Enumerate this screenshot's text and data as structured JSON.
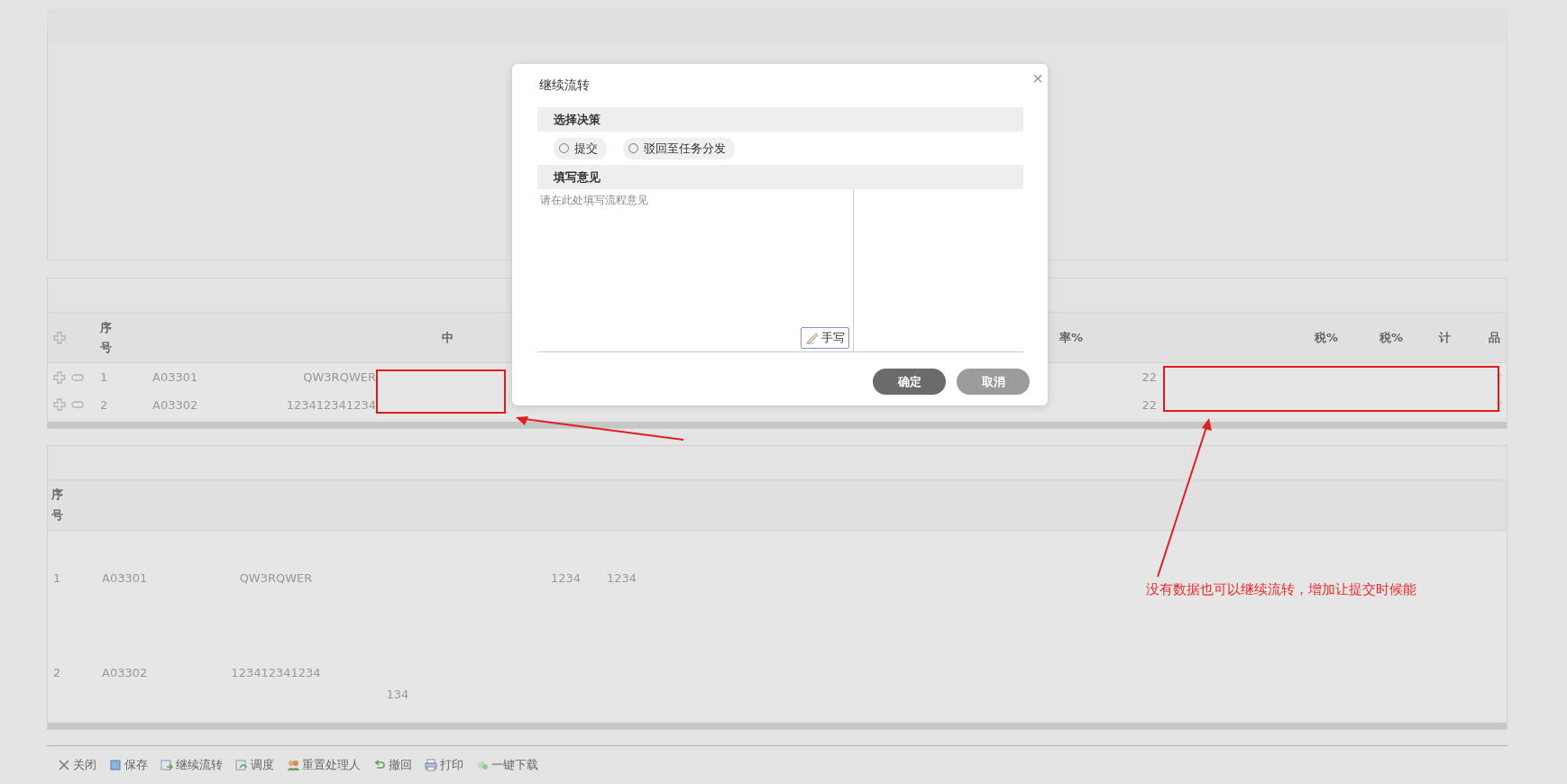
{
  "detail_table": {
    "headers": {
      "index": "序号",
      "column_4": "中",
      "column_6": "率%",
      "column_9": "税%",
      "column_10": "税%",
      "column_11": "计",
      "column_12": "品"
    },
    "rows": [
      {
        "index": "1",
        "code": "A03301",
        "name": "QW3RQWER",
        "amount": "22"
      },
      {
        "index": "2",
        "code": "A03302",
        "name": "123412341234",
        "amount": "22"
      }
    ]
  },
  "list_table": {
    "header": "序号",
    "rows": [
      {
        "index": "1",
        "code": "A03301",
        "name": "QW3RQWER",
        "column_5": "1234",
        "column_6": "1234"
      },
      {
        "index": "2",
        "code": "A03302",
        "name": "123412341234",
        "column_4": "134"
      }
    ]
  },
  "toolbar": [
    {
      "kind": "close",
      "label": "关闭"
    },
    {
      "kind": "save",
      "label": "保存"
    },
    {
      "kind": "forward",
      "label": "继续流转"
    },
    {
      "kind": "dispatch",
      "label": "调度"
    },
    {
      "kind": "reassign",
      "label": "重置处理人"
    },
    {
      "kind": "undo",
      "label": "撤回"
    },
    {
      "kind": "print",
      "label": "打印"
    },
    {
      "kind": "download",
      "label": "一键下载"
    }
  ],
  "dialog": {
    "title": "继续流转",
    "close": "×",
    "decision_heading": "选择决策",
    "options": [
      {
        "label": "提交",
        "selected": false
      },
      {
        "label": "驳回至任务分发",
        "selected": false
      }
    ],
    "opinion_heading": "填写意见",
    "opinion_placeholder": "请在此处填写流程意见",
    "handwrite_button": "手写",
    "buttons": [
      {
        "kind": "primary",
        "label": "确定"
      },
      {
        "kind": "secondary",
        "label": "取消"
      }
    ]
  },
  "annotation": "没有数据也可以继续流转，增加让提交时候能"
}
